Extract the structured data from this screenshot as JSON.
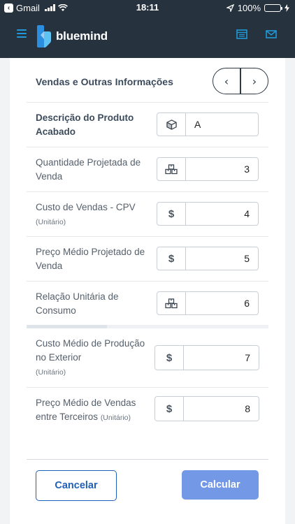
{
  "status_bar": {
    "back_app": "Gmail",
    "time": "18:11",
    "battery": "100%"
  },
  "app": {
    "brand": "bluemind"
  },
  "section": {
    "title": "Vendas e Outras Informações",
    "prev_glyph": "‹",
    "next_glyph": "›"
  },
  "rows": [
    {
      "label": "Descrição do Produto Acabado",
      "sub": "",
      "addon": "box-icon",
      "value": "A"
    },
    {
      "label": "Quantidade Projetada de Venda",
      "sub": "",
      "addon": "boxes-icon",
      "value": "3"
    },
    {
      "label": "Custo de Vendas - CPV",
      "sub": "(Unitário)",
      "addon": "$",
      "value": "4"
    },
    {
      "label": "Preço Médio Projetado de Venda",
      "sub": "",
      "addon": "$",
      "value": "5"
    },
    {
      "label": "Relação Unitária de Consumo",
      "sub": "",
      "addon": "boxes-icon",
      "value": "6"
    },
    {
      "label": "Custo Médio de Produção no Exterior",
      "sub": "(Unitário)",
      "addon": "$",
      "value": "7"
    },
    {
      "label": "Preço Médio de Vendas entre Terceiros",
      "sub": "(Unitário)",
      "addon": "$",
      "value": "8"
    }
  ],
  "buttons": {
    "cancel": "Cancelar",
    "calculate": "Calcular"
  },
  "colors": {
    "header_bg": "#26333f",
    "accent": "#1f9ad6",
    "primary": "#1f5fb8",
    "calc_bg": "#7399e6"
  }
}
